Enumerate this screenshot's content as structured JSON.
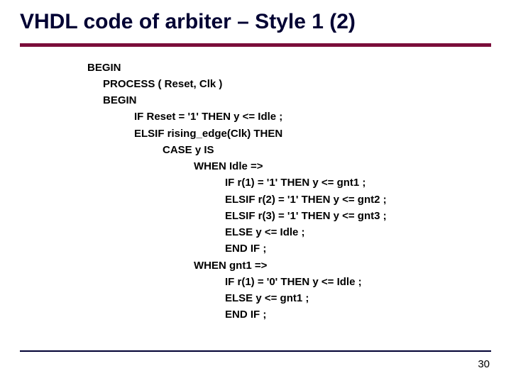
{
  "title": "VHDL code of arbiter – Style 1 (2)",
  "code": {
    "l00": "BEGIN",
    "l01": "PROCESS ( Reset, Clk )",
    "l02": "BEGIN",
    "l03": "IF Reset = '1' THEN y <= Idle ;",
    "l04": "ELSIF rising_edge(Clk) THEN",
    "l05": "CASE y IS",
    "l06": "WHEN Idle =>",
    "l07": "IF r(1) = '1' THEN y <= gnt1 ;",
    "l08": "ELSIF r(2) = '1' THEN y <= gnt2 ;",
    "l09": "ELSIF r(3) = '1' THEN y <= gnt3 ;",
    "l10": "ELSE y <= Idle ;",
    "l11": "END IF ;",
    "l12": "WHEN gnt1 =>",
    "l13": "IF r(1) = '0' THEN y <= Idle ;",
    "l14": "ELSE y <= gnt1 ;",
    "l15": "END IF ;"
  },
  "page_number": "30"
}
